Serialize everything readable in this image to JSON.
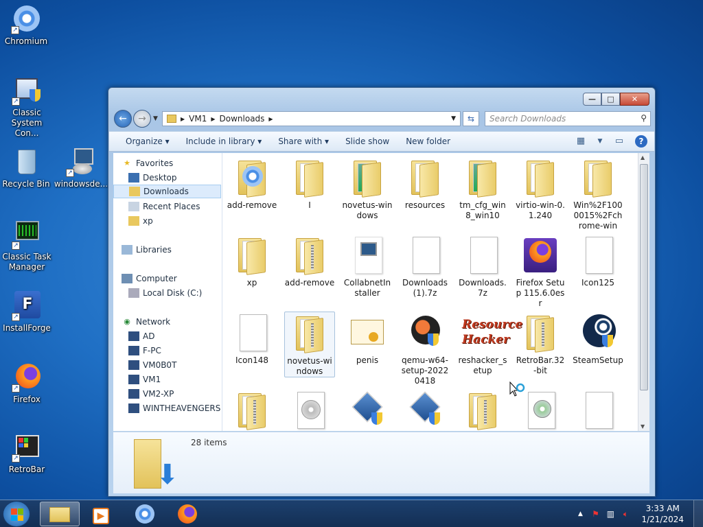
{
  "desktop": {
    "icons": [
      {
        "label": "Chromium",
        "icon": "chromium-icon"
      },
      {
        "label": "Classic System Con...",
        "icon": "control-panel-icon"
      },
      {
        "label": "Recycle Bin",
        "icon": "recycle-bin-icon"
      },
      {
        "label": "windowsde...",
        "icon": "installer-icon"
      },
      {
        "label": "Classic Task Manager",
        "icon": "task-manager-icon"
      },
      {
        "label": "InstallForge",
        "icon": "installforge-icon"
      },
      {
        "label": "Firefox",
        "icon": "firefox-icon"
      },
      {
        "label": "RetroBar",
        "icon": "retrobar-icon"
      }
    ]
  },
  "window": {
    "buttons": {
      "minimize": "—",
      "maximize": "□",
      "close": "✕"
    },
    "address": {
      "crumbs": [
        "VM1",
        "Downloads"
      ]
    },
    "search": {
      "placeholder": "Search Downloads"
    },
    "toolbar": {
      "organize": "Organize",
      "include": "Include in library",
      "share": "Share with",
      "slideshow": "Slide show",
      "newfolder": "New folder"
    },
    "nav": {
      "favorites": "Favorites",
      "desktop": "Desktop",
      "downloads": "Downloads",
      "recent": "Recent Places",
      "xp": "xp",
      "libraries": "Libraries",
      "computer": "Computer",
      "localdisk": "Local Disk (C:)",
      "network": "Network",
      "net_items": [
        "AD",
        "F-PC",
        "VM0B0T",
        "VM1",
        "VM2-XP",
        "WINTHEAVENGERS"
      ]
    },
    "files": [
      {
        "name": "add-remove",
        "kind": "chromium"
      },
      {
        "name": "I",
        "kind": "folder-doc"
      },
      {
        "name": "novetus-windows",
        "kind": "folder-img"
      },
      {
        "name": "resources",
        "kind": "folder-doc"
      },
      {
        "name": "tm_cfg_win8_win10",
        "kind": "folder-img"
      },
      {
        "name": "virtio-win-0.1.240",
        "kind": "folder-doc"
      },
      {
        "name": "Win%2F1000015%2Fchrome-win",
        "kind": "folder-stack"
      },
      {
        "name": "xp",
        "kind": "folder-doc"
      },
      {
        "name": "add-remove",
        "kind": "zip"
      },
      {
        "name": "CollabnetInstaller",
        "kind": "installer"
      },
      {
        "name": "Downloads (1).7z",
        "kind": "doc"
      },
      {
        "name": "Downloads.7z",
        "kind": "doc"
      },
      {
        "name": "Firefox Setup 115.6.0esr",
        "kind": "firefox-setup"
      },
      {
        "name": "Icon125",
        "kind": "doc"
      },
      {
        "name": "Icon148",
        "kind": "doc"
      },
      {
        "name": "novetus-windows",
        "kind": "zip"
      },
      {
        "name": "penis",
        "kind": "certificate"
      },
      {
        "name": "qemu-w64-setup-20220418",
        "kind": "qemu"
      },
      {
        "name": "reshacker_setup",
        "kind": "reshacker"
      },
      {
        "name": "RetroBar.32-bit",
        "kind": "zip"
      },
      {
        "name": "SteamSetup",
        "kind": "steam"
      },
      {
        "name": "",
        "kind": "zip"
      },
      {
        "name": "",
        "kind": "disc"
      },
      {
        "name": "",
        "kind": "virtualbox"
      },
      {
        "name": "",
        "kind": "virtualbox"
      },
      {
        "name": "",
        "kind": "zip"
      },
      {
        "name": "",
        "kind": "cd-installer"
      },
      {
        "name": "",
        "kind": "doc"
      }
    ],
    "details": {
      "count": "28 items"
    }
  },
  "taskbar": {
    "clock_time": "3:33 AM",
    "clock_date": "1/21/2024",
    "tray_arrow": "▲"
  }
}
